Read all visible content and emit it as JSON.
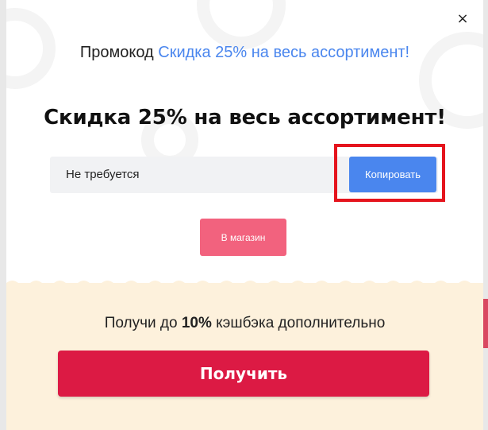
{
  "modal": {
    "close_icon": "×",
    "promo_prefix": "Промокод ",
    "promo_title": "Скидка 25% на весь ассортимент!",
    "headline": "Скидка 25% на весь ассортимент!",
    "code_value": "Не требуется",
    "copy_label": "Копировать",
    "shop_label": "В магазин",
    "cashback_before": "Получи до ",
    "cashback_bold": "10%",
    "cashback_after": " кэшбэка дополнительно",
    "get_label": "Получить"
  },
  "colors": {
    "accent_blue": "#4a86ee",
    "shop_pink": "#f2627e",
    "get_red": "#dc1a44",
    "highlight_red": "#e5141d",
    "cashback_bg": "#fdf1dc"
  },
  "icons": {
    "close": "close-icon"
  }
}
